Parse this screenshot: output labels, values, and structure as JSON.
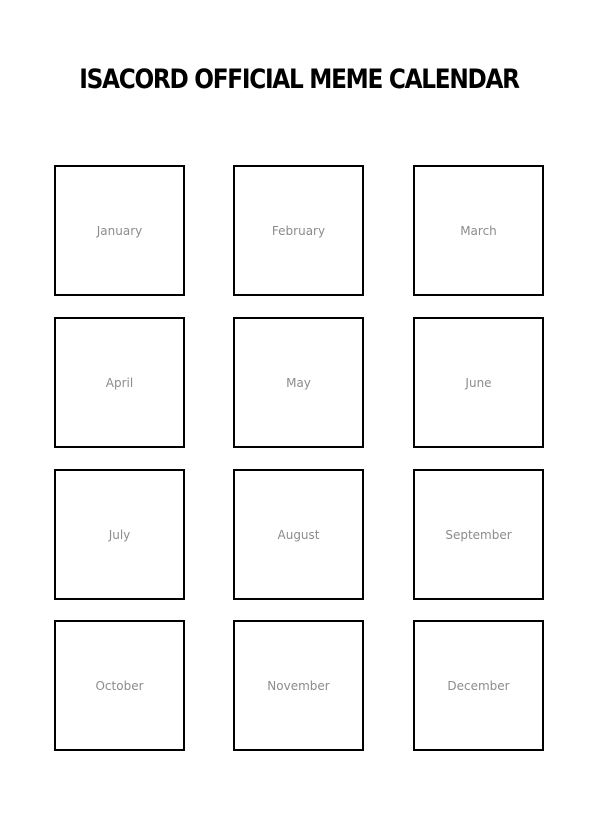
{
  "title": "ISACORD OFFICIAL MEME CALENDAR",
  "months": [
    {
      "label": "January"
    },
    {
      "label": "February"
    },
    {
      "label": "March"
    },
    {
      "label": "April"
    },
    {
      "label": "May"
    },
    {
      "label": "June"
    },
    {
      "label": "July"
    },
    {
      "label": "August"
    },
    {
      "label": "September"
    },
    {
      "label": "October"
    },
    {
      "label": "November"
    },
    {
      "label": "December"
    }
  ],
  "colors": {
    "border": "#000000",
    "month_label": "#8c8c8c",
    "background": "#ffffff"
  }
}
